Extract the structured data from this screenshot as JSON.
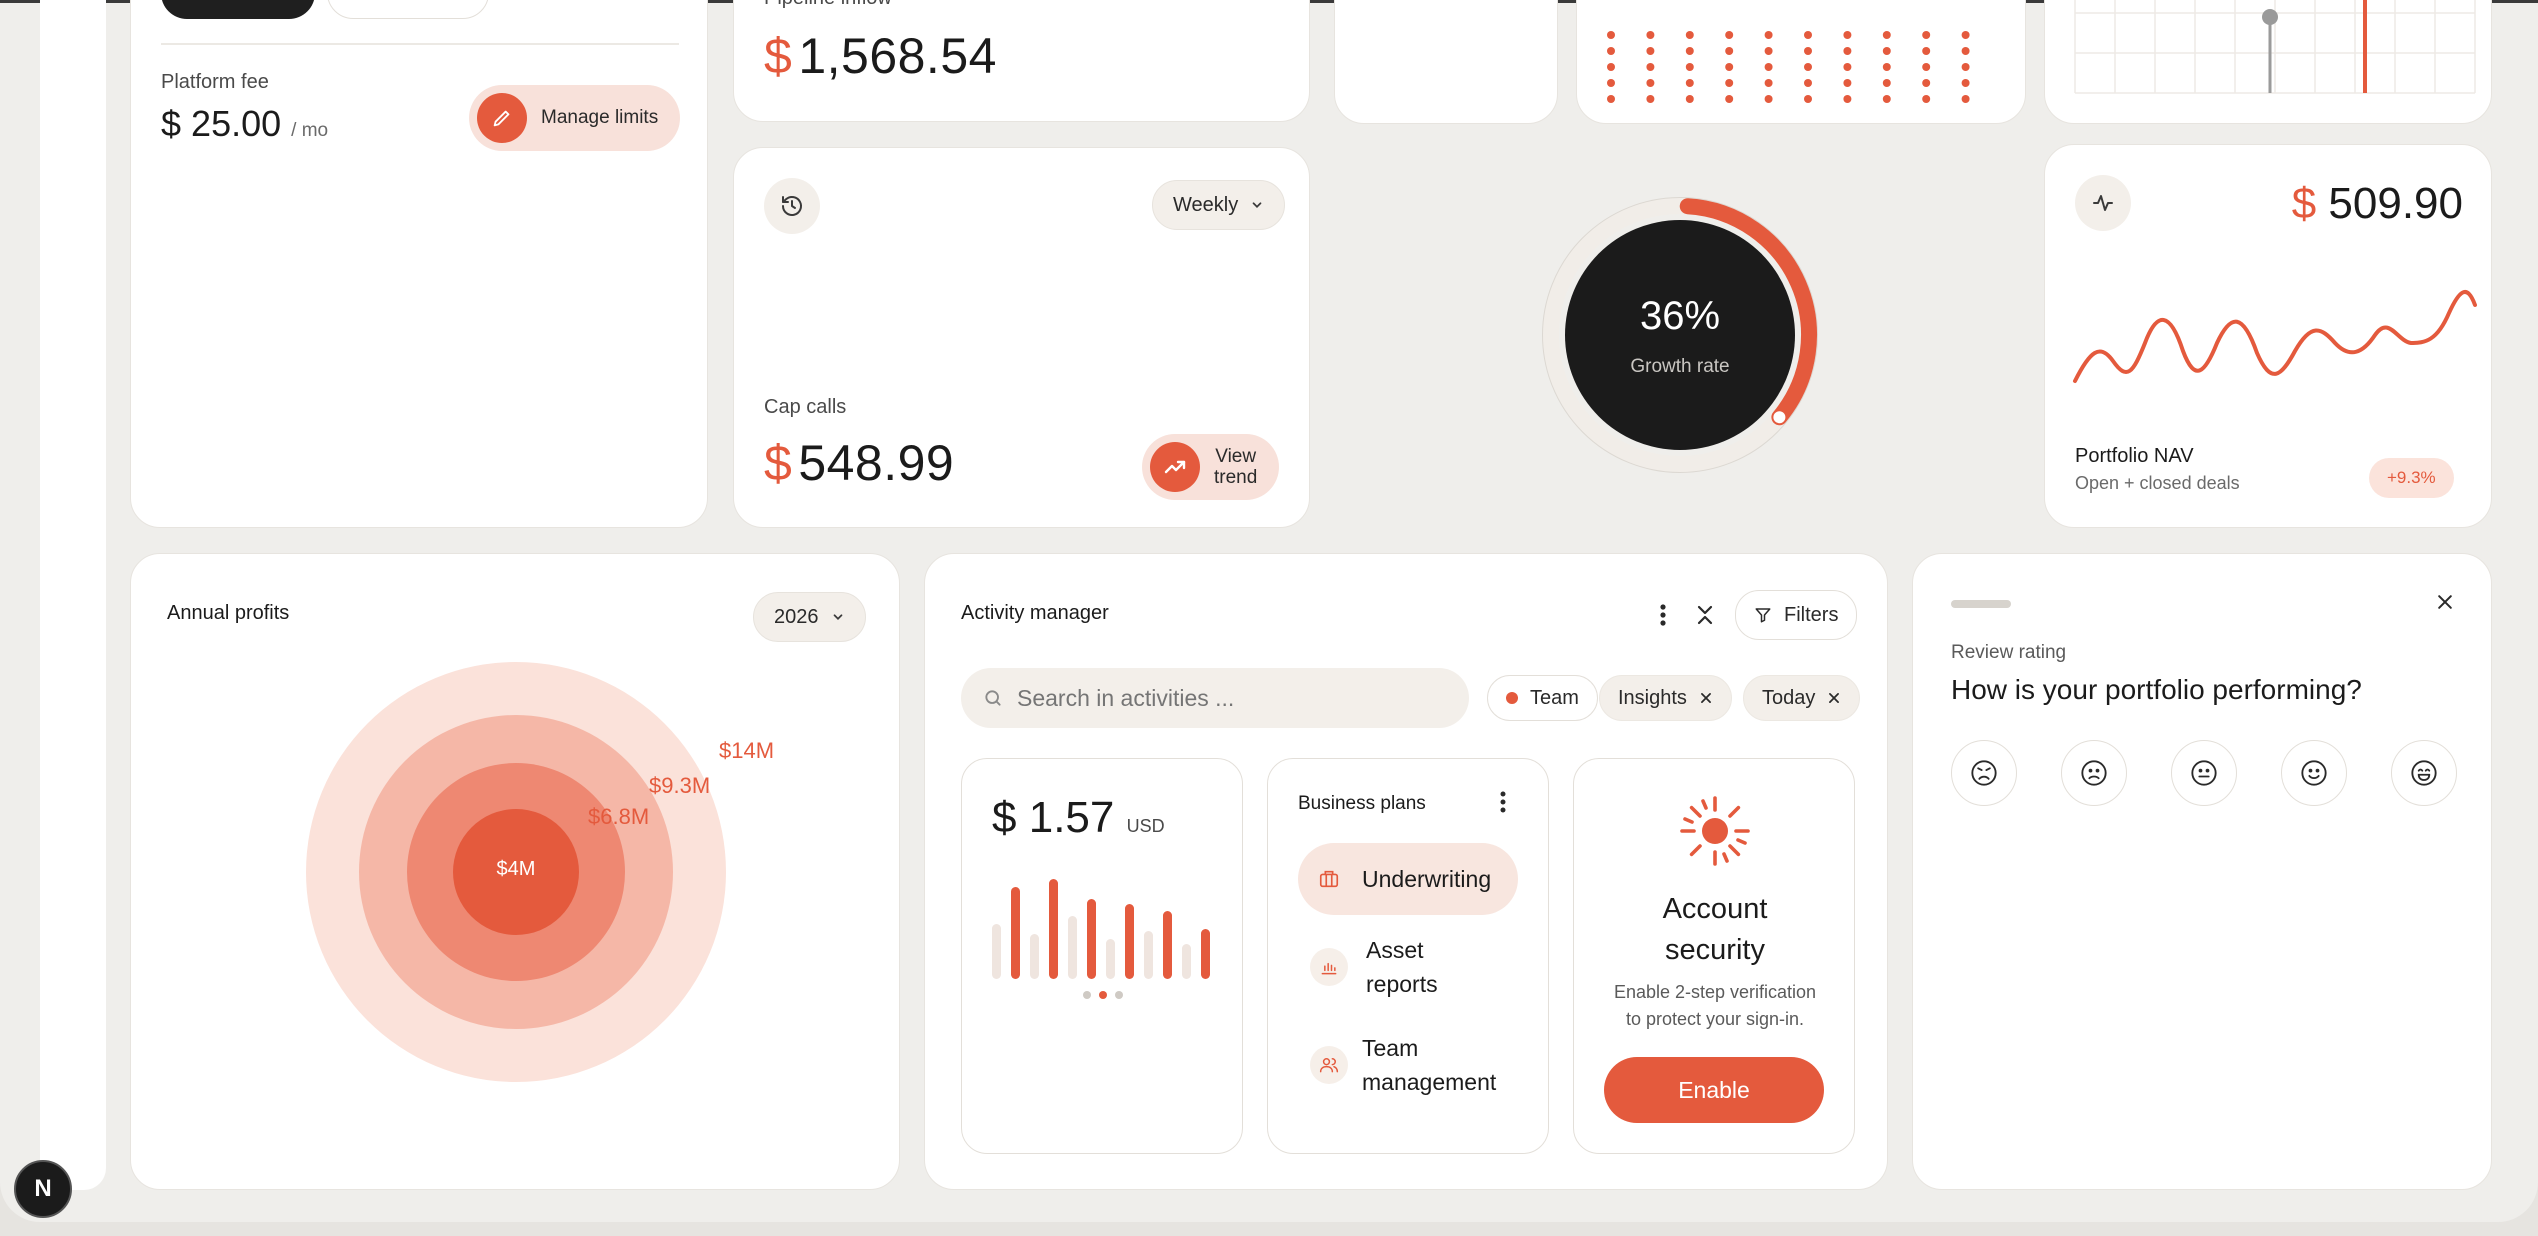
{
  "colors": {
    "accent": "#e45a3d",
    "dark": "#1b1b1b",
    "background": "#efeeeb"
  },
  "billing": {
    "fee_label": "Platform fee",
    "fee_currency": "$",
    "fee_value": "25.00",
    "fee_period": "/ mo",
    "manage_label": "Manage limits",
    "manage_icon": "pencil-icon"
  },
  "pipeline": {
    "label": "Pipeline inflow",
    "currency": "$",
    "value": "1,568.54"
  },
  "cap_calls": {
    "label": "Cap calls",
    "currency": "$",
    "value": "548.99",
    "period": "Weekly",
    "history_icon": "history-icon",
    "trend_label_1": "View",
    "trend_label_2": "trend",
    "trend_icon": "trending-up-icon"
  },
  "growth": {
    "value": "36%",
    "label": "Growth rate",
    "progress": 0.36
  },
  "portfolio": {
    "currency": "$",
    "value": "509.90",
    "title": "Portfolio NAV",
    "subtitle": "Open + closed deals",
    "change": "+9.3%",
    "icon": "activity-icon"
  },
  "annual": {
    "title": "Annual profits",
    "year": "2026",
    "rings": [
      "$14M",
      "$9.3M",
      "$6.8M",
      "$4M"
    ]
  },
  "activity": {
    "title": "Activity manager",
    "filters_label": "Filters",
    "search_placeholder": "Search in activities ...",
    "chips": {
      "team": "Team",
      "insights": "Insights",
      "today": "Today"
    },
    "balance": {
      "currency": "$",
      "value": "1.57",
      "unit": "USD",
      "bars": [
        0.55,
        0.92,
        0.45,
        1.0,
        0.63,
        0.8,
        0.4,
        0.75,
        0.48,
        0.68,
        0.35,
        0.5
      ]
    },
    "plans": {
      "title": "Business plans",
      "items": [
        {
          "line1": "Underwriting",
          "line2": "",
          "icon": "briefcase-icon"
        },
        {
          "line1": "Asset",
          "line2": "reports",
          "icon": "bar-chart-icon"
        },
        {
          "line1": "Team",
          "line2": "management",
          "icon": "users-icon"
        }
      ]
    },
    "security": {
      "title_1": "Account",
      "title_2": "security",
      "desc_1": "Enable 2-step verification",
      "desc_2": "to protect your sign-in.",
      "button": "Enable",
      "icon": "sun-icon"
    }
  },
  "review": {
    "label": "Review rating",
    "question": "How is your portfolio performing?",
    "faces": [
      "very-sad-face-icon",
      "sad-face-icon",
      "neutral-face-icon",
      "smile-face-icon",
      "happy-face-icon"
    ]
  },
  "avatar_letter": "N"
}
